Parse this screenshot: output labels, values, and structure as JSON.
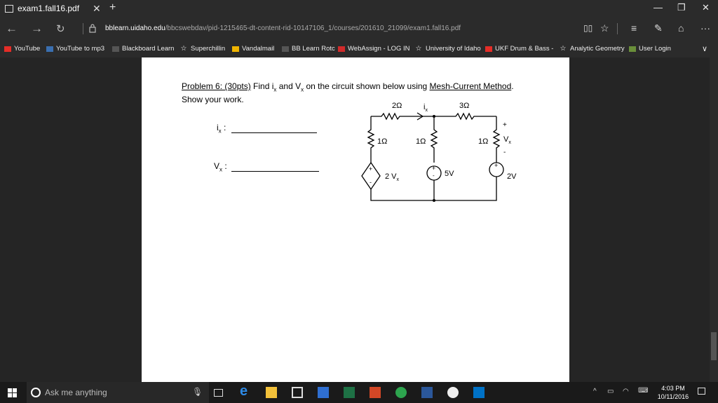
{
  "tab": {
    "title": "exam1.fall16.pdf",
    "close": "✕",
    "new": "+"
  },
  "window": {
    "minimize": "—",
    "restore": "❐",
    "close": "✕"
  },
  "address": {
    "domain": "bblearn.uidaho.edu",
    "path": "/bbcswebdav/pid-1215465-dt-content-rid-10147106_1/courses/201610_21099/exam1.fall16.pdf"
  },
  "favorites": [
    {
      "label": "YouTube",
      "icon": "youtube-icon",
      "color": "#e52d27"
    },
    {
      "label": "YouTube to mp3",
      "icon": "mp3-icon",
      "color": "#3a6fb0"
    },
    {
      "label": "Blackboard Learn",
      "icon": "blackboard-icon",
      "color": "#555555"
    },
    {
      "label": "Superchillin",
      "icon": "star-icon",
      "color": ""
    },
    {
      "label": "Vandalmail",
      "icon": "vandalmail-icon",
      "color": "#f0b400"
    },
    {
      "label": "BB Learn Rotc",
      "icon": "blackboard-icon",
      "color": "#555555"
    },
    {
      "label": "WebAssign - LOG IN",
      "icon": "webassign-icon",
      "color": "#d12a2a"
    },
    {
      "label": "University of Idaho",
      "icon": "star-icon",
      "color": ""
    },
    {
      "label": "UKF Drum & Bass -",
      "icon": "youtube-icon",
      "color": "#e52d27"
    },
    {
      "label": "Analytic Geometry",
      "icon": "star-icon",
      "color": ""
    },
    {
      "label": "User Login",
      "icon": "user-login-icon",
      "color": "#6a8f3a"
    }
  ],
  "document": {
    "problem_num": "Problem 6: (30pts)",
    "problem_text_a": " Find i",
    "sub_x": "x",
    "problem_text_b": " and V",
    "problem_text_c": " on the circuit shown below using ",
    "method": "Mesh-Current Method",
    "period": ".",
    "line2": "Show your work.",
    "ix_label": "i",
    "vx_label": "V",
    "colon": " :"
  },
  "circuit": {
    "r_top_left": "2Ω",
    "r_top_right": "3Ω",
    "current": "i",
    "current_sub": "x",
    "r1": "1Ω",
    "r2": "1Ω",
    "r3": "1Ω",
    "vx": "V",
    "vx_sub": "x",
    "plus": "+",
    "minus": "-",
    "dep_src": "2 V",
    "dep_sub": "x",
    "src2": "5V",
    "src3": "2V"
  },
  "taskbar": {
    "search_placeholder": "Ask me anything",
    "time": "4:03 PM",
    "date": "10/11/2016"
  }
}
